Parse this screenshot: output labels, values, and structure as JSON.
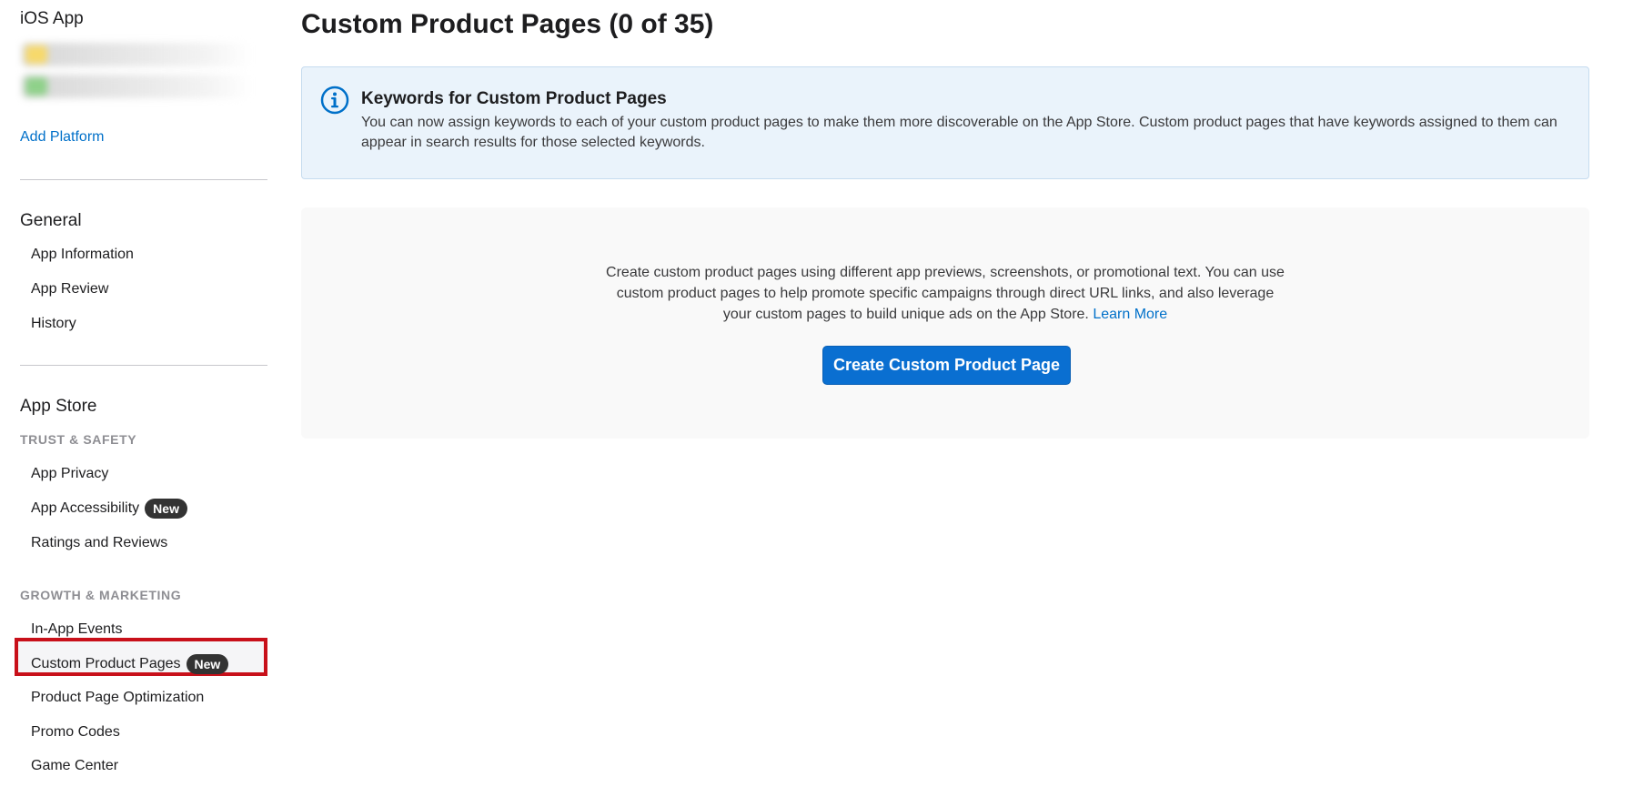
{
  "sidebar": {
    "platform_title": "iOS App",
    "add_platform": "Add Platform",
    "general": {
      "title": "General",
      "items": [
        "App Information",
        "App Review",
        "History"
      ]
    },
    "app_store": {
      "title": "App Store",
      "trust_safety_label": "TRUST & SAFETY",
      "trust_items": [
        "App Privacy",
        "App Accessibility",
        "Ratings and Reviews"
      ],
      "growth_label": "GROWTH & MARKETING",
      "growth_items": [
        "In-App Events",
        "Custom Product Pages",
        "Product Page Optimization",
        "Promo Codes",
        "Game Center"
      ],
      "new_badge": "New"
    }
  },
  "main": {
    "title": "Custom Product Pages (0 of 35)",
    "info": {
      "title": "Keywords for Custom Product Pages",
      "text": "You can now assign keywords to each of your custom product pages to make them more discoverable on the App Store. Custom product pages that have keywords assigned to them can appear in search results for those selected keywords.",
      "icon": "info-circle-icon"
    },
    "empty_state": {
      "text": "Create custom product pages using different app previews, screenshots, or promotional text. You can use custom product pages to help promote specific campaigns through direct URL links, and also leverage your custom pages to build unique ads on the App Store.",
      "learn_more": "Learn More",
      "button": "Create Custom Product Page"
    }
  },
  "colors": {
    "accent": "#0070c9",
    "button": "#0a6fd1",
    "info_bg": "#eaf3fb",
    "badge_bg": "#333333",
    "highlight": "#c8101a"
  }
}
